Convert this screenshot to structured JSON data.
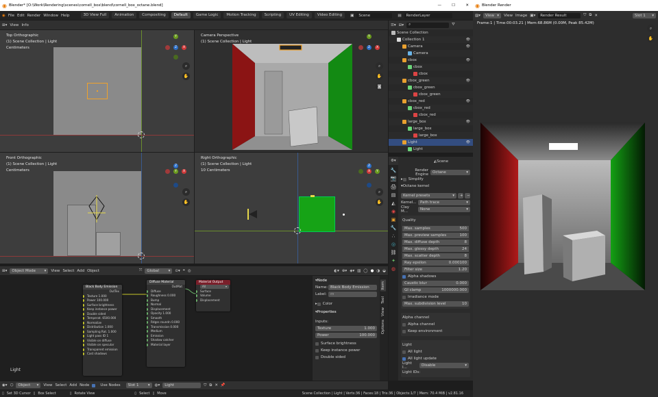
{
  "window": {
    "title": "Blender* [O:\\Work\\Rendering\\scenes\\cornell_box\\blend\\cornell_box_octane.blend]"
  },
  "topbar": {
    "menus": [
      "File",
      "Edit",
      "Render",
      "Window",
      "Help"
    ],
    "workspaces": [
      "3D View Full",
      "Animation",
      "Compositing",
      "Default",
      "Game Logic",
      "Motion Tracking",
      "Scripting",
      "UV Editing",
      "Video Editing"
    ],
    "active_workspace": "Default",
    "scene": "Scene",
    "view_layer": "RenderLayer"
  },
  "viewport_header": {
    "menus": [
      "View",
      "Info"
    ]
  },
  "viewports": {
    "top": {
      "line1": "Top Orthographic",
      "line2": "(1) Scene Collection | Light",
      "line3": "Centimeters"
    },
    "camera": {
      "line1": "Camera Perspective",
      "line2": "(1) Scene Collection | Light"
    },
    "front": {
      "line1": "Front Orthographic",
      "line2": "(1) Scene Collection | Light",
      "line3": "Centimeters"
    },
    "right": {
      "line1": "Right Orthographic",
      "line2": "(1) Scene Collection | Light",
      "line3": "10 Centimeters"
    }
  },
  "gizmo": {
    "x": "X",
    "y": "Y",
    "z": "Z"
  },
  "viewport_bottom": {
    "mode": "Object Mode",
    "menus": [
      "View",
      "Select",
      "Add",
      "Object"
    ],
    "transform": "Global"
  },
  "node_editor": {
    "label": "Light",
    "header_menus": [
      "View",
      "Select",
      "Add",
      "Node"
    ],
    "object": "Object",
    "use_nodes": "Use Nodes",
    "slot": "Slot 1",
    "light": "Light",
    "nodes": {
      "emission": {
        "title": "Black Body Emission",
        "out": "OutTex",
        "rows": [
          "Texture 1.000",
          "Power 100.000",
          "Surface brightness",
          "Keep instance power",
          "Double sided",
          "Temperat. 6500.000",
          "Normalize",
          "Distribution 1.000",
          "Sampling Rat. 1.000",
          "Light pass ID 1",
          "Visible on diffuse",
          "Visible on specular",
          "Transparent emission",
          "Cast shadows"
        ]
      },
      "diffuse": {
        "title": "Diffuse Material",
        "out": "OutMat",
        "rows": [
          "Diffuse",
          "Roughness 0.000",
          "Bump",
          "Normal",
          "Displacement",
          "Opacity 1.000",
          "Smooth",
          "Rdgss roundn 0.000",
          "Transmission 0.000",
          "Medium",
          "Emission",
          "Shadow catcher",
          "Material layer"
        ]
      },
      "output": {
        "title": "Material Output",
        "dropdown": "All",
        "rows": [
          "Surface",
          "Volume",
          "Displacement"
        ]
      }
    },
    "sidebar": {
      "title": "Node",
      "name_label": "Name:",
      "name": "Black Body Emission",
      "label_label": "Label:",
      "color": "Color",
      "properties": "Properties",
      "inputs": "Inputs:",
      "texture_label": "Texture",
      "texture": "1.000",
      "power_label": "Power",
      "power": "100.000",
      "rows": [
        "Surface brightness",
        "Keep instance power",
        "Double sided"
      ],
      "tabs": [
        "Item",
        "Tool",
        "View",
        "Options"
      ]
    }
  },
  "statusbar": {
    "items": [
      "Set 3D Cursor",
      "Box Select",
      "Rotate View",
      "Select",
      "Move"
    ],
    "info": "Scene Collection | Light | Verts:36 | Faces:18 | Tris:36 | Objects:1/7 | Mem: 70.4 MiB | v2.81.16"
  },
  "outliner": {
    "items": [
      {
        "label": "Scene Collection",
        "indent": 0,
        "type": "scene"
      },
      {
        "label": "Collection 1",
        "indent": 1,
        "type": "coll"
      },
      {
        "label": "Camera",
        "indent": 2,
        "type": "obj"
      },
      {
        "label": "Camera",
        "indent": 3,
        "type": "data"
      },
      {
        "label": "cbox",
        "indent": 2,
        "type": "obj"
      },
      {
        "label": "cbox",
        "indent": 3,
        "type": "mesh"
      },
      {
        "label": "cbox",
        "indent": 4,
        "type": "mat"
      },
      {
        "label": "cbox_green",
        "indent": 2,
        "type": "obj"
      },
      {
        "label": "cbox_green",
        "indent": 3,
        "type": "mesh"
      },
      {
        "label": "cbox_green",
        "indent": 4,
        "type": "mat"
      },
      {
        "label": "cbox_red",
        "indent": 2,
        "type": "obj"
      },
      {
        "label": "cbox_red",
        "indent": 3,
        "type": "mesh"
      },
      {
        "label": "cbox_red",
        "indent": 4,
        "type": "mat"
      },
      {
        "label": "large_box",
        "indent": 2,
        "type": "obj"
      },
      {
        "label": "large_box",
        "indent": 3,
        "type": "mesh"
      },
      {
        "label": "large_box",
        "indent": 4,
        "type": "mat"
      },
      {
        "label": "Light",
        "indent": 2,
        "type": "obj",
        "selected": true
      },
      {
        "label": "Light",
        "indent": 3,
        "type": "mesh"
      }
    ]
  },
  "properties": {
    "scene": "Scene",
    "render_engine_label": "Render Engine",
    "render_engine": "Octane",
    "simplify": "Simplify",
    "octane_kernel": "Octane kernel",
    "kernel_presets": "Kernel presets",
    "kernel_label": "Kernel...",
    "kernel": "Path trace",
    "clay_label": "Clay M...",
    "clay": "None",
    "quality": "Quality",
    "quality_rows": [
      {
        "label": "Max. samples",
        "value": "500"
      },
      {
        "label": "Max. preview samples",
        "value": "100"
      },
      {
        "label": "Max. diffuse depth",
        "value": "8"
      },
      {
        "label": "Max. glossy depth",
        "value": "24"
      },
      {
        "label": "Max. scatter depth",
        "value": "8"
      },
      {
        "label": "Ray epsilon",
        "value": "0.000100"
      },
      {
        "label": "Filter size",
        "value": "1.20"
      }
    ],
    "alpha_shadows": "Alpha shadows",
    "caustic": {
      "label": "Caustic blur",
      "value": "0.000"
    },
    "gi": {
      "label": "GI clamp",
      "value": "1000000.000"
    },
    "irradiance": "Irradiance mode",
    "subdiv": {
      "label": "Max. subdivision level",
      "value": "10"
    },
    "alpha_channel": "Alpha channel",
    "alpha_channel_cb": "Alpha channel",
    "keep_env": "Keep environment",
    "light": "Light",
    "all_light": "All light",
    "all_light_update": "All light update",
    "light_label": "Light I...",
    "light_value": "Disable",
    "light_ids": "Light IDs:"
  },
  "render_window": {
    "title": "Blender Render",
    "menus": [
      "View",
      "View",
      "Image"
    ],
    "result": "Render Result",
    "slot": "Slot 1",
    "frame_info": "Frame:1 | Time:00:03.21 | Mem:68.86M (0.00M, Peak 85.42M)"
  },
  "colors": {
    "accent": "#4772b3",
    "red_wall": "#8b1414",
    "green_wall": "#138a13",
    "selected": "#f0a22a"
  }
}
